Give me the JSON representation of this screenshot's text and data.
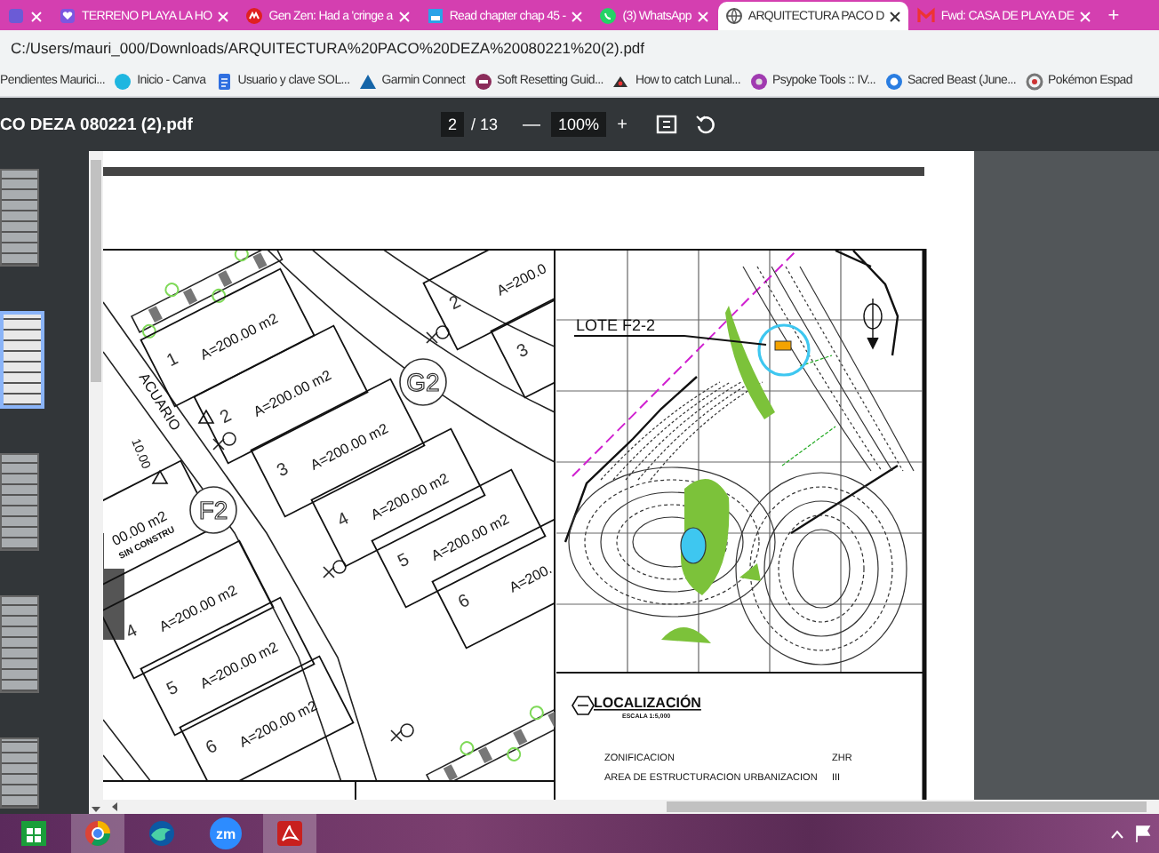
{
  "browser": {
    "tabs": [
      {
        "selected": false
      },
      {
        "title": "TERRENO PLAYA LA HO",
        "selected": false
      },
      {
        "title": "Gen Zen: Had a 'cringe a",
        "selected": false
      },
      {
        "title": "Read chapter chap 45 -",
        "selected": false
      },
      {
        "title": "(3) WhatsApp",
        "selected": false
      },
      {
        "title": "ARQUITECTURA PACO D",
        "selected": true
      },
      {
        "title": "Fwd: CASA DE PLAYA DE",
        "selected": false
      }
    ],
    "new_tab": "+",
    "address": "C:/Users/mauri_000/Downloads/ARQUITECTURA%20PACO%20DEZA%20080221%20(2).pdf",
    "bookmarks": [
      "Pendientes Maurici...",
      "Inicio - Canva",
      "Usuario y clave SOL...",
      "Garmin Connect",
      "Soft Resetting Guid...",
      "How to catch Lunal...",
      "Psypoke Tools :: IV...",
      "Sacred Beast (June...",
      "Pokémon Espad"
    ]
  },
  "pdf_toolbar": {
    "file_name": "CO DEZA 080221 (2).pdf",
    "page": "2",
    "page_total": "/ 13",
    "zoom_out": "—",
    "zoom": "100%",
    "zoom_in": "+"
  },
  "thumbnails": [
    {
      "selected": false
    },
    {
      "selected": true
    },
    {
      "selected": false
    },
    {
      "selected": false
    },
    {
      "selected": false
    }
  ],
  "plan": {
    "lots": [
      {
        "number": "1",
        "area": "A=200.00 m2"
      },
      {
        "number": "2",
        "area": "A=200.00 m2"
      },
      {
        "number": "3",
        "area": "A=200.00 m2"
      },
      {
        "number": "4",
        "area": "A=200.00 m2"
      },
      {
        "number": "5",
        "area": "A=200.00 m2"
      },
      {
        "number": "6",
        "area": "A=200."
      },
      {
        "number": "2",
        "area": "A=200.0"
      },
      {
        "number": "3"
      },
      {
        "area": "00.00 m2",
        "note": "SIN CONSTRU"
      },
      {
        "number": "4",
        "area": "A=200.00 m2"
      },
      {
        "number": "5",
        "area": "A=200.00 m2"
      },
      {
        "number": "6",
        "area": "A=200.00 m2"
      }
    ],
    "street": "ACUARIO",
    "dimension": "10.00",
    "markers": [
      "G2",
      "F2"
    ]
  },
  "location_map": {
    "lot_label": "LOTE F2-2",
    "title": "LOCALIZACIÓN",
    "scale": "ESCALA 1:5,000",
    "rows": [
      {
        "label": "ZONIFICACION",
        "value": "ZHR"
      },
      {
        "label": "AREA DE ESTRUCTURACION URBANIZACION",
        "value": "III"
      }
    ]
  },
  "taskbar": {
    "apps": [
      {
        "kind": "store",
        "active": false
      },
      {
        "kind": "ring",
        "active": true
      },
      {
        "kind": "wave",
        "active": false
      },
      {
        "kind": "meeting",
        "label": "zm",
        "active": false
      },
      {
        "kind": "reader",
        "active": true
      }
    ]
  }
}
